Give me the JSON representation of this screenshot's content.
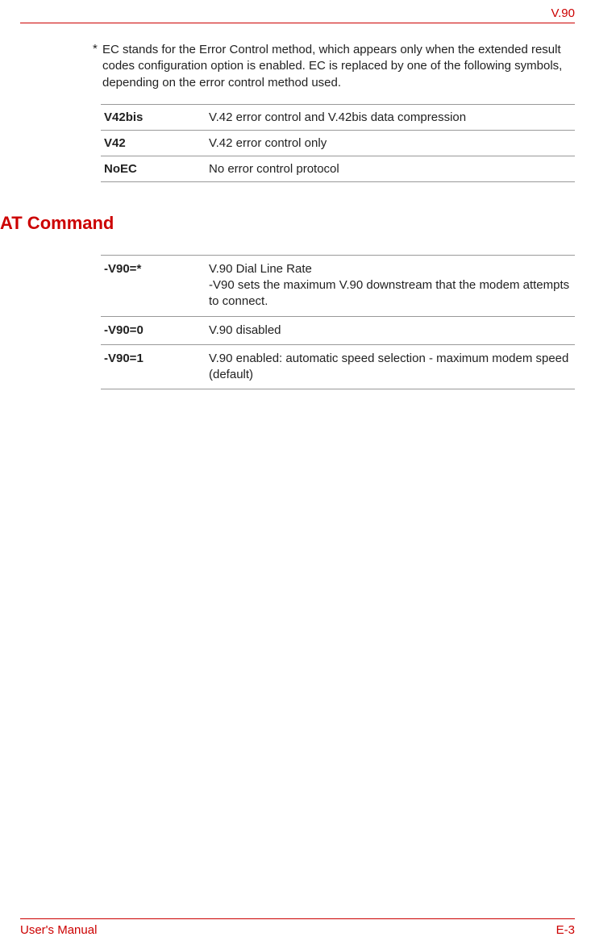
{
  "header": {
    "right": "V.90"
  },
  "note": {
    "star": "*",
    "text": "EC stands for the Error Control method, which appears only when the extended result codes configuration option is enabled. EC is replaced by one of the following symbols, depending on the error control method used."
  },
  "ec_table": [
    {
      "code": "V42bis",
      "desc": "V.42 error control and V.42bis data compression"
    },
    {
      "code": "V42",
      "desc": "V.42 error control only"
    },
    {
      "code": "NoEC",
      "desc": "No error control protocol"
    }
  ],
  "section_heading": "AT Command",
  "at_table": [
    {
      "code": "-V90=*",
      "desc1": "V.90 Dial Line Rate",
      "desc2": "-V90 sets the maximum V.90 downstream that the modem attempts to connect."
    },
    {
      "code": "-V90=0",
      "desc1": "V.90 disabled",
      "desc2": ""
    },
    {
      "code": "-V90=1",
      "desc1": "V.90 enabled: automatic speed selection - maximum modem speed (default)",
      "desc2": ""
    }
  ],
  "footer": {
    "left": "User's Manual",
    "right": "E-3"
  }
}
